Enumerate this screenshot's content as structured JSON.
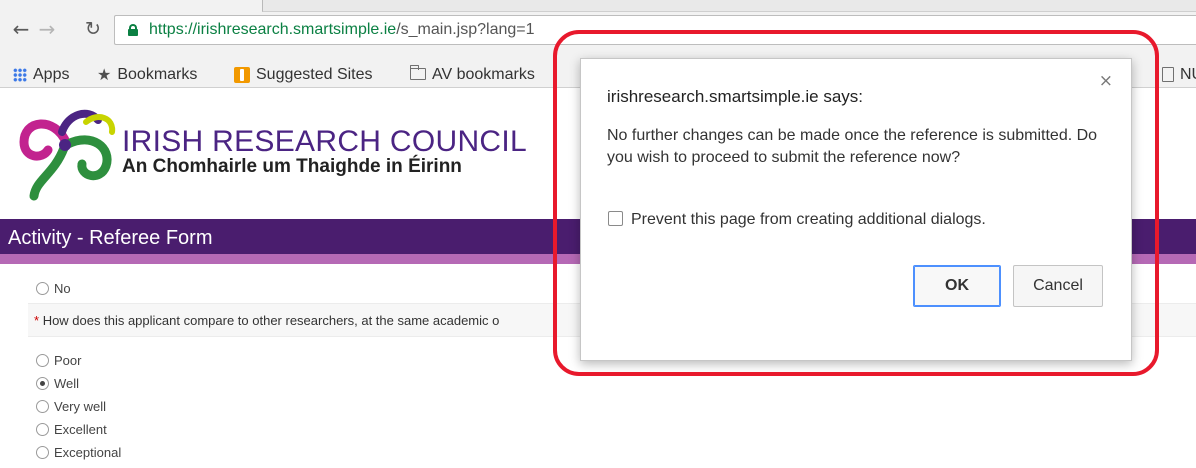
{
  "browser": {
    "url_host": "https://irishresearch.smartsimple.ie",
    "url_path": "/s_main.jsp?lang=1",
    "bookmarks": [
      {
        "label": "Apps",
        "icon": "apps-grid-icon"
      },
      {
        "label": "Bookmarks",
        "icon": "star-icon"
      },
      {
        "label": "Suggested Sites",
        "icon": "suggested-sites-icon"
      },
      {
        "label": "AV bookmarks",
        "icon": "folder-icon"
      },
      {
        "label": "NU",
        "icon": "page-icon"
      }
    ]
  },
  "header": {
    "org_name": "IRISH RESEARCH COUNCIL",
    "org_name_irish": "An Chomhairle um Thaighde in Éirinn",
    "logo_colors": [
      "#c2238f",
      "#2e8f3e",
      "#4b2483",
      "#c8d400"
    ]
  },
  "activity_bar": {
    "title": "Activity - Referee Form"
  },
  "form": {
    "prev_option": {
      "label": "No",
      "selected": false
    },
    "question": "How does this applicant compare to other researchers, at the same academic o",
    "required_marker": "*",
    "options": [
      {
        "label": "Poor",
        "selected": false
      },
      {
        "label": "Well",
        "selected": true
      },
      {
        "label": "Very well",
        "selected": false
      },
      {
        "label": "Excellent",
        "selected": false
      },
      {
        "label": "Exceptional",
        "selected": false
      }
    ]
  },
  "dialog": {
    "title": "irishresearch.smartsimple.ie says:",
    "message": "No further changes can be made once the reference is submitted. Do you wish to proceed to submit the reference now?",
    "checkbox_label": "Prevent this page from creating additional dialogs.",
    "checkbox_checked": false,
    "ok_label": "OK",
    "cancel_label": "Cancel",
    "close_glyph": "×"
  },
  "colors": {
    "annotation": "#e8192c",
    "activity_bar": "#4a1d6e",
    "activity_strip": "#b569b5",
    "org_name": "#4b2483"
  }
}
